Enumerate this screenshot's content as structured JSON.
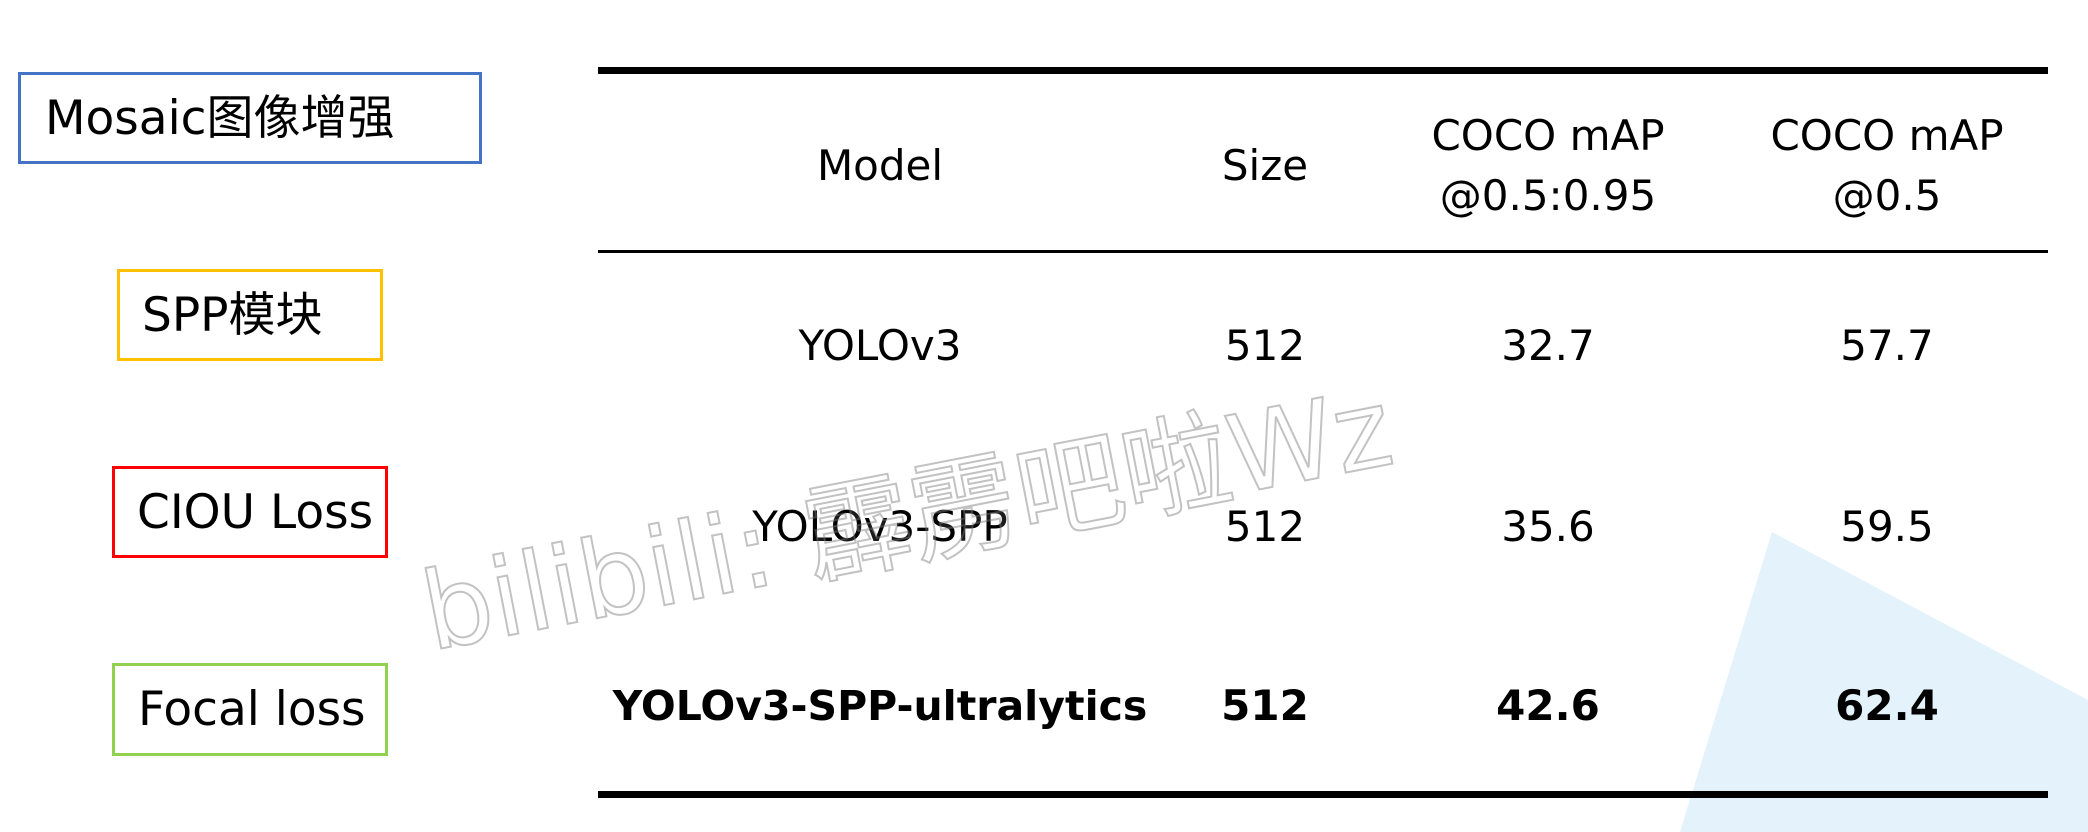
{
  "colors": {
    "mosaic_border": "#4472c4",
    "spp_border": "#ffc000",
    "ciou_border": "#ff0000",
    "focal_border": "#92d050",
    "accent_shape": "#e3f2fb"
  },
  "tags": {
    "mosaic": "Mosaic图像增强",
    "spp": "SPP模块",
    "ciou": "CIOU Loss",
    "focal": "Focal loss"
  },
  "table": {
    "headers": {
      "model": "Model",
      "size": "Size",
      "map_range_line1": "COCO mAP",
      "map_range_line2": "@0.5:0.95",
      "map50_line1": "COCO mAP",
      "map50_line2": "@0.5"
    },
    "rows": [
      {
        "model": "YOLOv3",
        "size": "512",
        "map_range": "32.7",
        "map50": "57.7"
      },
      {
        "model": "YOLOv3-SPP",
        "size": "512",
        "map_range": "35.6",
        "map50": "59.5"
      },
      {
        "model": "YOLOv3-SPP-ultralytics",
        "size": "512",
        "map_range": "42.6",
        "map50": "62.4"
      }
    ]
  },
  "watermark": "bilibili: 霹雳吧啦Wz"
}
